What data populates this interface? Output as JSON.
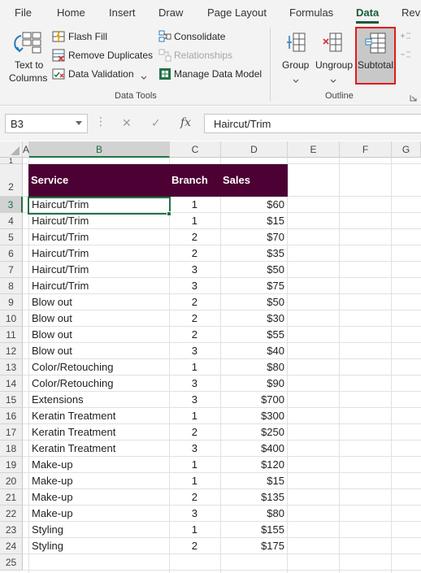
{
  "tabs": [
    "File",
    "Home",
    "Insert",
    "Draw",
    "Page Layout",
    "Formulas",
    "Data",
    "Revi"
  ],
  "active_tab": "Data",
  "ribbon": {
    "text_to_columns": [
      "Text to",
      "Columns"
    ],
    "flash_fill": "Flash Fill",
    "remove_duplicates": "Remove Duplicates",
    "data_validation": "Data Validation",
    "consolidate": "Consolidate",
    "relationships": "Relationships",
    "manage_data_model": "Manage Data Model",
    "data_tools_label": "Data Tools",
    "group": "Group",
    "ungroup": "Ungroup",
    "subtotal": "Subtotal",
    "outline_label": "Outline"
  },
  "formula_bar": {
    "name_box": "B3",
    "fx": "fx",
    "content": "Haircut/Trim"
  },
  "columns": [
    "A",
    "B",
    "C",
    "D",
    "E",
    "F",
    "G"
  ],
  "selected_column": "B",
  "selected_row": 3,
  "table": {
    "headers": [
      "Service",
      "Branch",
      "Sales"
    ],
    "rows": [
      {
        "row": 3,
        "service": "Haircut/Trim",
        "branch": "1",
        "sales": "$60"
      },
      {
        "row": 4,
        "service": "Haircut/Trim",
        "branch": "1",
        "sales": "$15"
      },
      {
        "row": 5,
        "service": "Haircut/Trim",
        "branch": "2",
        "sales": "$70"
      },
      {
        "row": 6,
        "service": "Haircut/Trim",
        "branch": "2",
        "sales": "$35"
      },
      {
        "row": 7,
        "service": "Haircut/Trim",
        "branch": "3",
        "sales": "$50"
      },
      {
        "row": 8,
        "service": "Haircut/Trim",
        "branch": "3",
        "sales": "$75"
      },
      {
        "row": 9,
        "service": "Blow out",
        "branch": "2",
        "sales": "$50"
      },
      {
        "row": 10,
        "service": "Blow out",
        "branch": "2",
        "sales": "$30"
      },
      {
        "row": 11,
        "service": "Blow out",
        "branch": "2",
        "sales": "$55"
      },
      {
        "row": 12,
        "service": "Blow out",
        "branch": "3",
        "sales": "$40"
      },
      {
        "row": 13,
        "service": "Color/Retouching",
        "branch": "1",
        "sales": "$80"
      },
      {
        "row": 14,
        "service": "Color/Retouching",
        "branch": "3",
        "sales": "$90"
      },
      {
        "row": 15,
        "service": "Extensions",
        "branch": "3",
        "sales": "$700"
      },
      {
        "row": 16,
        "service": "Keratin Treatment",
        "branch": "1",
        "sales": "$300"
      },
      {
        "row": 17,
        "service": "Keratin Treatment",
        "branch": "2",
        "sales": "$250"
      },
      {
        "row": 18,
        "service": "Keratin Treatment",
        "branch": "3",
        "sales": "$400"
      },
      {
        "row": 19,
        "service": "Make-up",
        "branch": "1",
        "sales": "$120"
      },
      {
        "row": 20,
        "service": "Make-up",
        "branch": "1",
        "sales": "$15"
      },
      {
        "row": 21,
        "service": "Make-up",
        "branch": "2",
        "sales": "$135"
      },
      {
        "row": 22,
        "service": "Make-up",
        "branch": "3",
        "sales": "$80"
      },
      {
        "row": 23,
        "service": "Styling",
        "branch": "1",
        "sales": "$155"
      },
      {
        "row": 24,
        "service": "Styling",
        "branch": "2",
        "sales": "$175"
      }
    ]
  },
  "extra_row_numbers": [
    "1",
    "2",
    "25"
  ],
  "colors": {
    "accent": "#217346",
    "header_fill": "#4c0033",
    "highlight_border": "#e11b1b"
  }
}
